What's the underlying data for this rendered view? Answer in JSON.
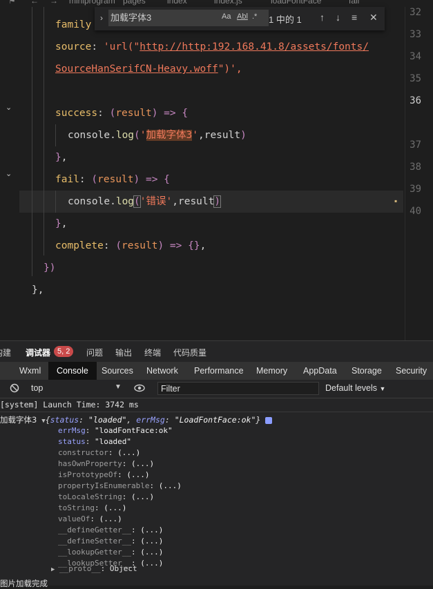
{
  "breadcrumb": {
    "items": [
      "miniprogram",
      "pages",
      "index",
      "index.js",
      "loadFontFace",
      "fail"
    ],
    "separator": ">"
  },
  "editor": {
    "lines": {
      "family_key": "family",
      "source_key": "source",
      "source_prefix": "'url(\"",
      "source_url": "http://http:192.168.41.8/assets/fonts/",
      "source_url_cont": "SourceHanSerifCN-Heavy.woff",
      "source_suffix": "\")',",
      "success_key": "success",
      "result": "result",
      "console": "console",
      "log": "log",
      "success_str": "加载字体3",
      "fail_key": "fail",
      "fail_str": "错误",
      "complete_key": "complete",
      "close_call": "})",
      "close_obj": "},"
    },
    "line_numbers": [
      "32",
      "33",
      "34",
      "35",
      "36",
      "37",
      "38",
      "39",
      "40"
    ],
    "active_line": "36"
  },
  "find_widget": {
    "query": "加载字体3",
    "opt_case": "Aa",
    "opt_word": "Abl",
    "opt_regex": ".*",
    "result_count": "1 中的 1",
    "up": "↑",
    "down": "↓",
    "menu": "≡",
    "close": "✕"
  },
  "devtools": {
    "top_tabs": {
      "build": "构建",
      "debugger": "调试器",
      "badge": "5, 2",
      "issues": "问题",
      "output": "输出",
      "terminal": "终端",
      "quality": "代码质量"
    },
    "panel_tabs": [
      "Wxml",
      "Console",
      "Sources",
      "Network",
      "Performance",
      "Memory",
      "AppData",
      "Storage",
      "Security"
    ],
    "active_panel": "Console",
    "toolbar": {
      "context": "top",
      "filter_placeholder": "Filter",
      "levels": "Default levels"
    },
    "console": {
      "launch_line": "[system] Launch Time: 3742 ms",
      "log_label": "加载字体3",
      "summary_open": "{",
      "summary_status_key": "status",
      "summary_status_val": "\"loaded\"",
      "summary_err_key": "errMsg",
      "summary_err_val": "\"LoadFontFace:ok\"",
      "summary_close": "}",
      "props": [
        {
          "key": "errMsg",
          "val": "\"loadFontFace:ok\""
        },
        {
          "key": "status",
          "val": "\"loaded\""
        },
        {
          "key": "constructor",
          "val": "(...)"
        },
        {
          "key": "hasOwnProperty",
          "val": "(...)"
        },
        {
          "key": "isPrototypeOf",
          "val": "(...)"
        },
        {
          "key": "propertyIsEnumerable",
          "val": "(...)"
        },
        {
          "key": "toLocaleString",
          "val": "(...)"
        },
        {
          "key": "toString",
          "val": "(...)"
        },
        {
          "key": "valueOf",
          "val": "(...)"
        },
        {
          "key": "__defineGetter__",
          "val": "(...)"
        },
        {
          "key": "__defineSetter__",
          "val": "(...)"
        },
        {
          "key": "__lookupGetter__",
          "val": "(...)"
        },
        {
          "key": "__lookupSetter__",
          "val": "(...)"
        }
      ],
      "proto_key": "__proto__",
      "proto_val": "Object",
      "bottom_line": "图片加载完成"
    }
  },
  "colors": {
    "background": "#1e1e1e",
    "keyword": "#e8bd6a",
    "string": "#f0795b",
    "badge": "#c94a4a"
  }
}
